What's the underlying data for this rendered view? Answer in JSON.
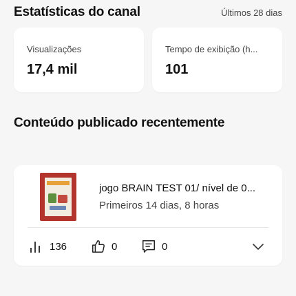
{
  "header": {
    "title": "Estatísticas do canal",
    "period": "Últimos 28 dias"
  },
  "stats": [
    {
      "label": "Visualizações",
      "value": "17,4 mil"
    },
    {
      "label": "Tempo de exibição (h...",
      "value": "101"
    }
  ],
  "recent": {
    "section_title": "Conteúdo publicado recentemente",
    "item": {
      "title": "jogo BRAIN TEST 01/ nível de 0...",
      "subtitle": "Primeiros 14 dias, 8 horas",
      "views": "136",
      "likes": "0",
      "comments": "0"
    }
  },
  "icons": {
    "views": "bar-chart-icon",
    "likes": "thumbs-up-icon",
    "comments": "comment-icon",
    "expand": "chevron-down-icon"
  }
}
